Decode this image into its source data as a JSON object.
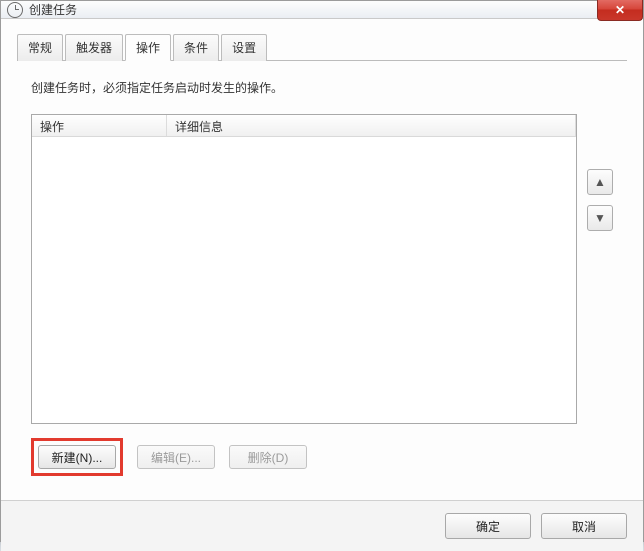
{
  "window": {
    "title": "创建任务"
  },
  "tabs": {
    "general": "常规",
    "triggers": "触发器",
    "actions": "操作",
    "conditions": "条件",
    "settings": "设置"
  },
  "panel": {
    "description": "创建任务时，必须指定任务启动时发生的操作。",
    "columns": {
      "action": "操作",
      "detail": "详细信息"
    },
    "buttons": {
      "new": "新建(N)...",
      "edit": "编辑(E)...",
      "delete": "删除(D)"
    },
    "arrows": {
      "up": "▲",
      "down": "▼"
    }
  },
  "footer": {
    "ok": "确定",
    "cancel": "取消"
  }
}
